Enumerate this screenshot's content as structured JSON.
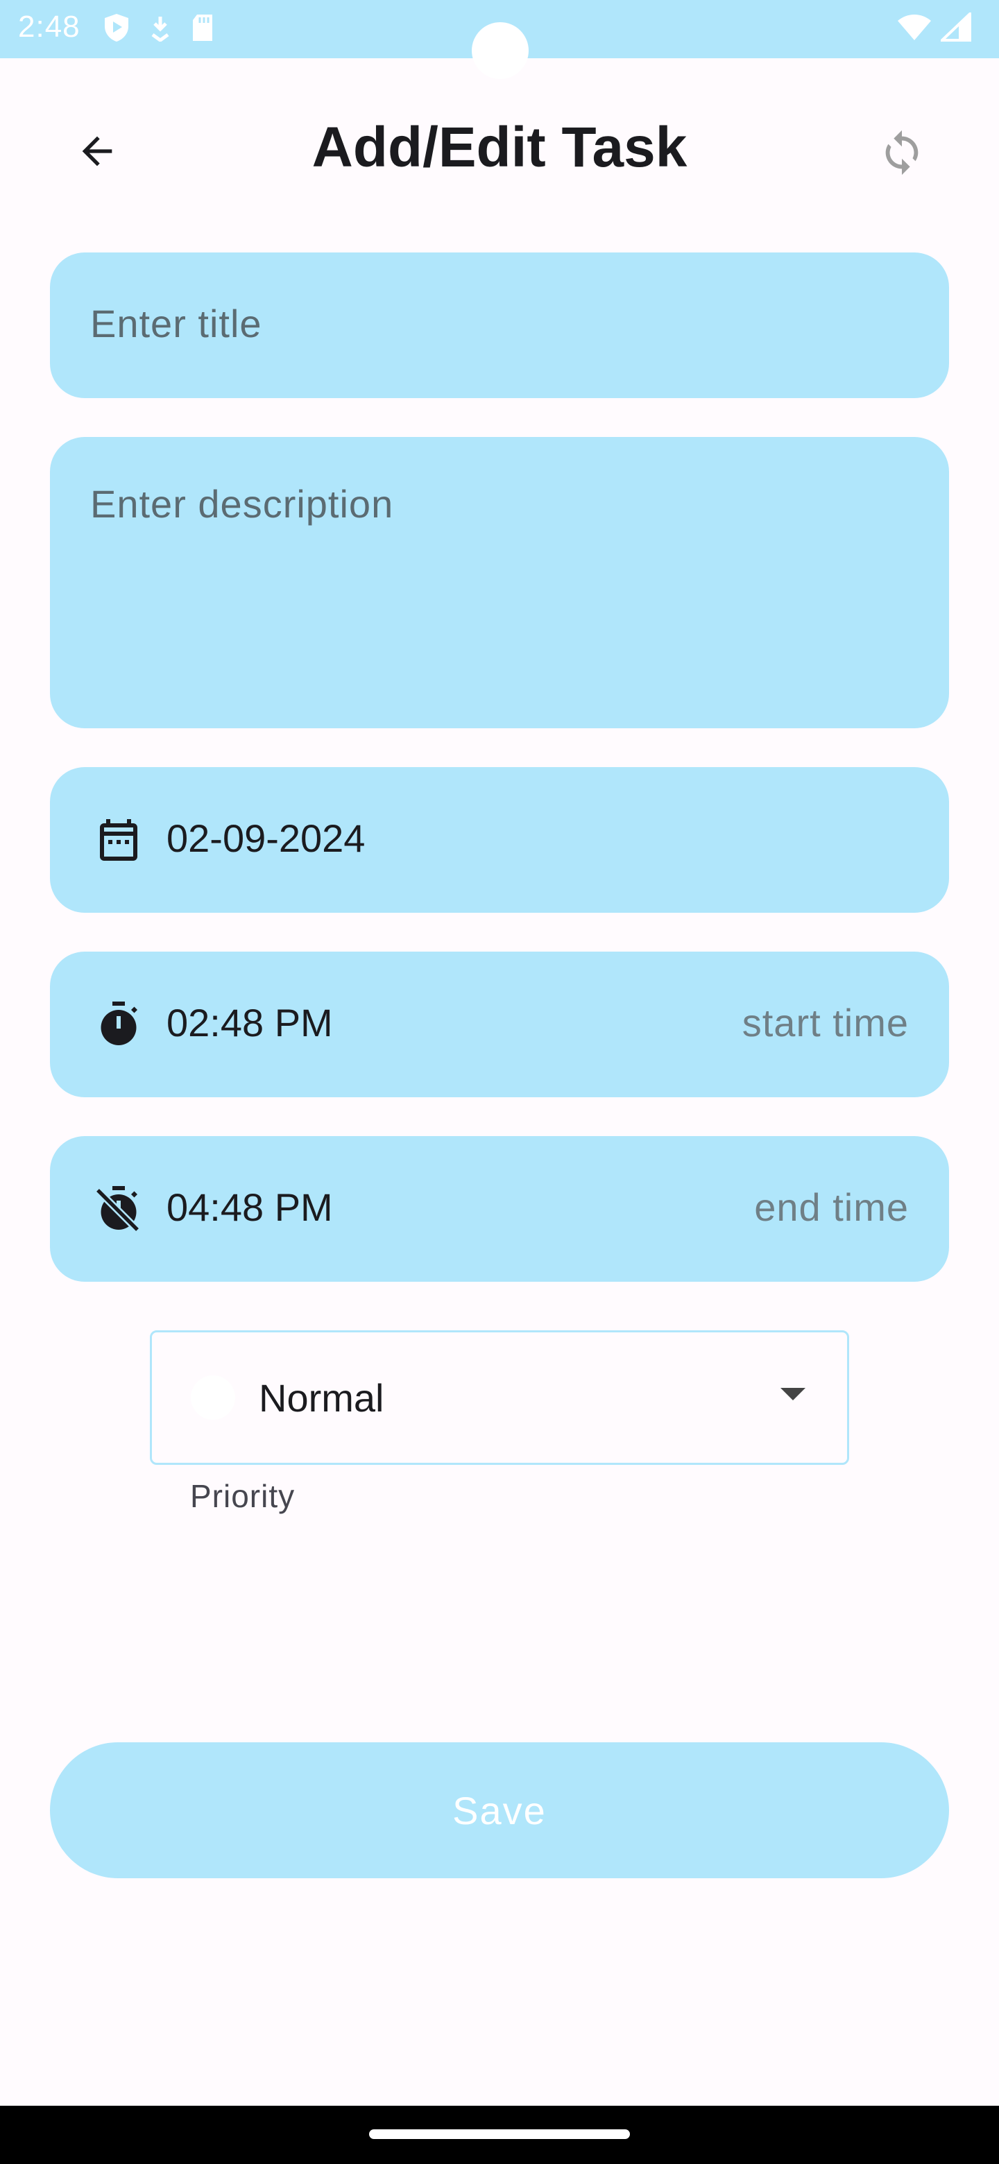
{
  "status_bar": {
    "time": "2:48",
    "left_icons": [
      "shield-play-icon",
      "download-icon",
      "sd-card-icon"
    ],
    "right_icons": [
      "wifi-icon",
      "signal-icon"
    ]
  },
  "header": {
    "title": "Add/Edit Task",
    "back_icon": "arrow-left-icon",
    "refresh_icon": "refresh-icon"
  },
  "form": {
    "title_placeholder": "Enter title",
    "description_placeholder": "Enter description",
    "date_value": "02-09-2024",
    "start_time_value": "02:48 PM",
    "start_time_hint": "start time",
    "end_time_value": "04:48 PM",
    "end_time_hint": "end time"
  },
  "priority": {
    "selected": "Normal",
    "label": "Priority"
  },
  "actions": {
    "save_label": "Save"
  },
  "colors": {
    "accent": "#b0e6fb",
    "background": "#fffbfe",
    "text_primary": "#1b1b1f",
    "text_hint": "#5b6b72"
  }
}
